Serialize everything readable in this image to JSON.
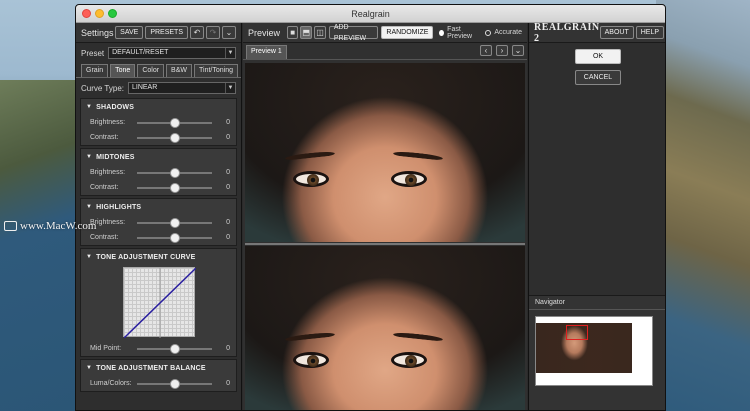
{
  "window": {
    "title": "Realgrain"
  },
  "settings": {
    "title": "Settings",
    "save_label": "SAVE",
    "presets_label": "PRESETS",
    "preset_label": "Preset",
    "preset_value": "DEFAULT/RESET",
    "tabs": [
      "Grain",
      "Tone",
      "Color",
      "B&W",
      "Tint/Toning"
    ],
    "active_tab": "Tone",
    "curve_type_label": "Curve Type:",
    "curve_type_value": "LINEAR",
    "sections": [
      {
        "title": "SHADOWS",
        "sliders": [
          {
            "label": "Brightness:",
            "value": "0",
            "level": 0.5
          },
          {
            "label": "Contrast:",
            "value": "0",
            "level": 0.5
          }
        ]
      },
      {
        "title": "MIDTONES",
        "sliders": [
          {
            "label": "Brightness:",
            "value": "0",
            "level": 0.5
          },
          {
            "label": "Contrast:",
            "value": "0",
            "level": 0.5
          }
        ]
      },
      {
        "title": "HIGHLIGHTS",
        "sliders": [
          {
            "label": "Brightness:",
            "value": "0",
            "level": 0.5
          },
          {
            "label": "Contrast:",
            "value": "0",
            "level": 0.5
          }
        ]
      }
    ],
    "curve_section": {
      "title": "TONE ADJUSTMENT CURVE",
      "midpoint_label": "Mid Point:",
      "midpoint_value": "0",
      "midpoint_level": 0.5
    },
    "balance_section": {
      "title": "TONE ADJUSTMENT BALANCE",
      "slider_label": "Luma/Colors:",
      "slider_value": "0",
      "slider_level": 0.5
    }
  },
  "preview": {
    "title": "Preview",
    "add_preview_label": "ADD PREVIEW",
    "randomize_label": "RANDOMIZE",
    "fast_preview_label": "Fast Preview",
    "accurate_label": "Accurate",
    "tab_label": "Preview 1"
  },
  "brand": {
    "logo_text": "REALGRAIN 2",
    "about_label": "ABOUT",
    "help_label": "HELP"
  },
  "actions": {
    "ok_label": "OK",
    "cancel_label": "CANCEL"
  },
  "navigator": {
    "title": "Navigator"
  },
  "watermark": {
    "text": "www.MacW.com"
  }
}
